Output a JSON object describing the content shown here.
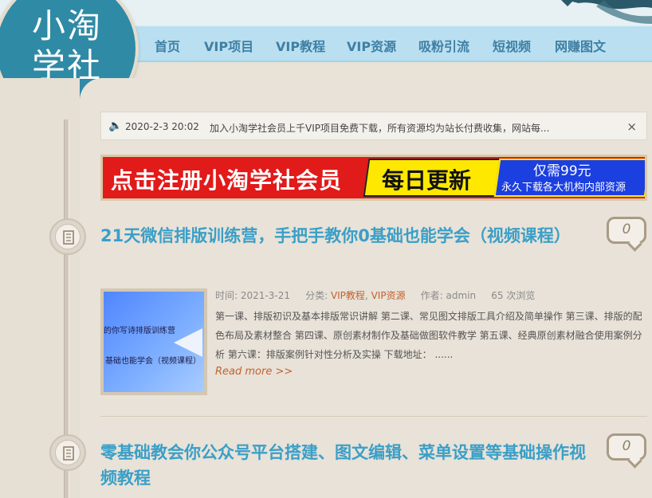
{
  "logo": {
    "line1": "小淘",
    "line2": "学社"
  },
  "nav": {
    "items": [
      "首页",
      "VIP项目",
      "VIP教程",
      "VIP资源",
      "吸粉引流",
      "短视频",
      "网赚图文"
    ]
  },
  "notice": {
    "date": "2020-2-3 20:02",
    "text": "加入小淘学社会员上千VIP项目免费下载，所有资源均为站长付费收集，网站每...",
    "close": "×",
    "icon": "speaker-icon"
  },
  "banner": {
    "left": "点击注册小淘学社会员",
    "middle": "每日更新",
    "right_top": "仅需99元",
    "right_bottom": "永久下载各大机构内部资源"
  },
  "posts": [
    {
      "title": "21天微信排版训练营，手把手教你0基础也能学会（视频课程）",
      "comments": "0",
      "thumb_line1": "的你写诗排版训练营",
      "thumb_line2": "基础也能学会（视频课程）",
      "meta_time_label": "时间:",
      "meta_time": "2021-3-21",
      "meta_cat_label": "分类:",
      "meta_cat1": "VIP教程",
      "meta_cat_sep": ",",
      "meta_cat2": "VIP资源",
      "meta_author_label": "作者:",
      "meta_author": "admin",
      "meta_views": "65 次浏览",
      "excerpt": "第一课、排版初识及基本排版常识讲解 第二课、常见图文排版工具介绍及简单操作 第三课、排版的配色布局及素材整合 第四课、原创素材制作及基础做图软件教学 第五课、经典原创素材融合使用案例分析 第六课：排版案例针对性分析及实操 下载地址：  ......",
      "readmore": "Read more >>"
    },
    {
      "title": "零基础教会你公众号平台搭建、图文编辑、菜单设置等基础操作视频教程",
      "comments": "0"
    }
  ],
  "colors": {
    "accent": "#3b9fc7",
    "nav_text": "#3f7fa3",
    "logo_bg": "#2f8aa5",
    "link": "#c2622e"
  }
}
